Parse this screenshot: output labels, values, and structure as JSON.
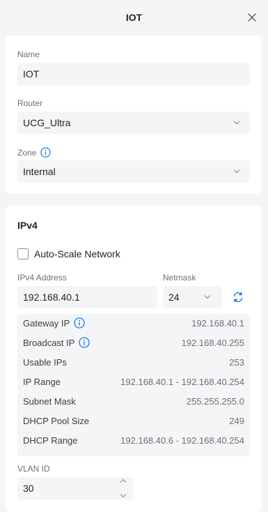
{
  "header": {
    "title": "IOT"
  },
  "general": {
    "name_label": "Name",
    "name_value": "IOT",
    "router_label": "Router",
    "router_value": "UCG_Ultra",
    "zone_label": "Zone",
    "zone_value": "Internal"
  },
  "ipv4": {
    "title": "IPv4",
    "auto_scale_label": "Auto-Scale Network",
    "address_label": "IPv4 Address",
    "address_value": "192.168.40.1",
    "netmask_label": "Netmask",
    "netmask_value": "24",
    "details": [
      {
        "key": "Gateway IP",
        "value": "192.168.40.1"
      },
      {
        "key": "Broadcast IP",
        "value": "192.168.40.255"
      },
      {
        "key": "Usable IPs",
        "value": "253"
      },
      {
        "key": "IP Range",
        "value": "192.168.40.1 - 192.168.40.254"
      },
      {
        "key": "Subnet Mask",
        "value": "255.255.255.0"
      },
      {
        "key": "DHCP Pool Size",
        "value": "249"
      },
      {
        "key": "DHCP Range",
        "value": "192.168.40.6 - 192.168.40.254"
      }
    ],
    "vlan_label": "VLAN ID",
    "vlan_value": "30"
  },
  "colors": {
    "accent": "#006fff",
    "field_bg": "#f4f5f6",
    "card_bg": "#ffffff"
  }
}
